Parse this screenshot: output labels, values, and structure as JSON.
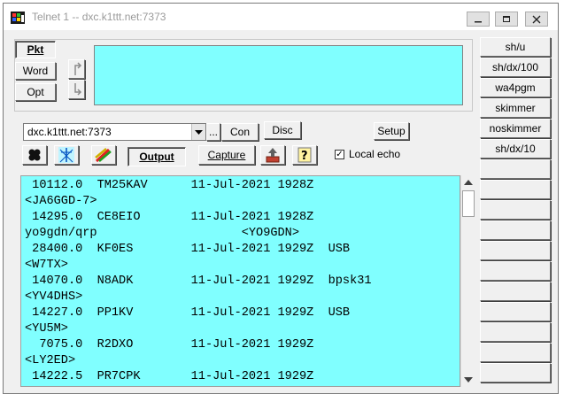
{
  "window": {
    "title": "Telnet 1 -- dxc.k1ttt.net:7373",
    "controls": [
      "minimize-icon",
      "maximize-icon",
      "close-icon"
    ]
  },
  "mode_buttons": [
    {
      "label": "Pkt",
      "pressed": true
    },
    {
      "label": "Word",
      "pressed": false
    },
    {
      "label": "Opt",
      "pressed": false
    }
  ],
  "scroll_icons": [
    "scroll-up-arrow-icon",
    "scroll-down-arrow-icon"
  ],
  "connection": {
    "host": "dxc.k1ttt.net:7373",
    "browse_label": "...",
    "connect_label": "Con",
    "disconnect_label": "Disc",
    "setup_label": "Setup"
  },
  "toolbar": {
    "icons": [
      "spots-icon",
      "antenna-icon",
      "colors-icon",
      "upload-icon",
      "help-icon"
    ],
    "output_label": "Output",
    "capture_label": "Capture",
    "local_echo_label": "Local echo",
    "local_echo_checked": true,
    "check_mark": "✓"
  },
  "terminal": {
    "lines": [
      " 10112.0  TM25KAV      11-Jul-2021 1928Z",
      "<JA6GGD-7>",
      " 14295.0  CE8EIO       11-Jul-2021 1928Z",
      "yo9gdn/qrp                    <YO9GDN>",
      " 28400.0  KF0ES        11-Jul-2021 1929Z  USB",
      "<W7TX>",
      " 14070.0  N8ADK        11-Jul-2021 1929Z  bpsk31",
      "<YV4DHS>",
      " 14227.0  PP1KV        11-Jul-2021 1929Z  USB",
      "<YU5M>",
      "  7075.0  R2DXO        11-Jul-2021 1929Z",
      "<LY2ED>",
      " 14222.5  PR7CPK       11-Jul-2021 1929Z"
    ]
  },
  "macros": [
    "sh/u",
    "sh/dx/100",
    "wa4pgm",
    "skimmer",
    "noskimmer",
    "sh/dx/10",
    "",
    "",
    "",
    "",
    "",
    "",
    "",
    "",
    "",
    "",
    ""
  ],
  "colors": {
    "cyan": "#80ffff",
    "face": "#f0f0f0"
  }
}
